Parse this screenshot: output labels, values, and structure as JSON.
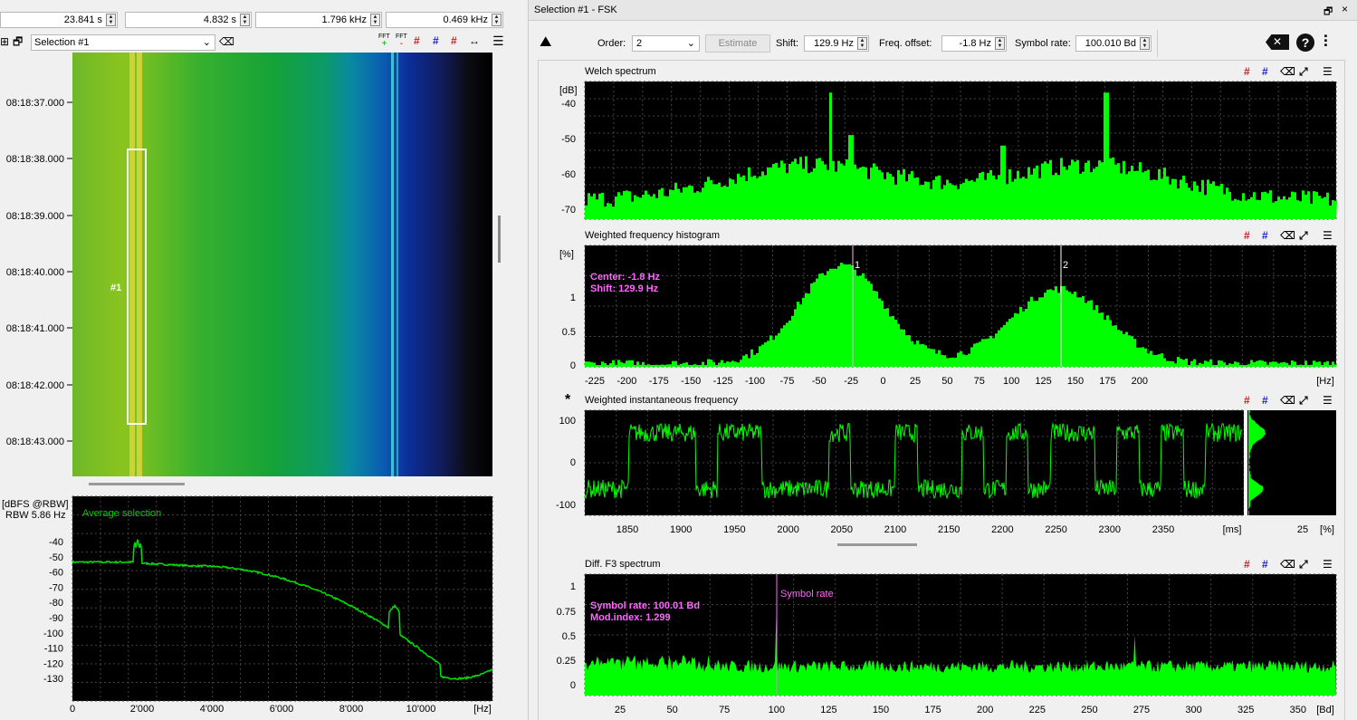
{
  "left_toolbar": {
    "time_start": "23.841 s",
    "time_span": "4.832 s",
    "freq_center": "1.796 kHz",
    "freq_span": "0.469 kHz",
    "selection_label": "Selection #1",
    "fft_plus": "FFT",
    "fft_minus": "FFT"
  },
  "waterfall": {
    "times": [
      "08:18:37.000",
      "08:18:38.000",
      "08:18:39.000",
      "08:18:40.000",
      "08:18:41.000",
      "08:18:42.000",
      "08:18:43.000"
    ],
    "marker": "#1"
  },
  "avg_spectrum": {
    "unit_label": "[dBFS @RBW]",
    "rbw": "RBW 5.86 Hz",
    "legend": "Average selection",
    "y_ticks": [
      "-40",
      "-50",
      "-60",
      "-70",
      "-80",
      "-90",
      "-100",
      "-110",
      "-120",
      "-130"
    ],
    "x_ticks": [
      "0",
      "2'000",
      "4'000",
      "6'000",
      "8'000",
      "10'000"
    ],
    "x_unit": "[Hz]"
  },
  "fsk_window": {
    "title": "Selection #1 - FSK",
    "order_label": "Order:",
    "order_value": "2",
    "estimate_label": "Estimate",
    "shift_label": "Shift:",
    "shift_value": "129.9 Hz",
    "offset_label": "Freq. offset:",
    "offset_value": "-1.8 Hz",
    "symrate_label": "Symbol rate:",
    "symrate_value": "100.010 Bd"
  },
  "welch": {
    "title": "Welch spectrum",
    "unit": "[dB]",
    "y_ticks": [
      "-40",
      "-50",
      "-60",
      "-70"
    ]
  },
  "histogram": {
    "title": "Weighted frequency histogram",
    "unit": "[%]",
    "y_ticks": [
      "1",
      "0.5",
      "0"
    ],
    "x_ticks": [
      "-225",
      "-200",
      "-175",
      "-150",
      "-125",
      "-100",
      "-75",
      "-50",
      "-25",
      "0",
      "25",
      "50",
      "75",
      "100",
      "125",
      "150",
      "175",
      "200"
    ],
    "x_unit": "[Hz]",
    "center_text": "Center: -1.8 Hz",
    "shift_text": "Shift:  129.9 Hz",
    "marker1": "1",
    "marker2": "2"
  },
  "inst_freq": {
    "title": "Weighted instantaneous frequency",
    "star": "*",
    "y_ticks": [
      "100",
      "0",
      "-100"
    ],
    "x_ticks": [
      "1850",
      "1900",
      "1950",
      "2000",
      "2050",
      "2100",
      "2150",
      "2200",
      "2250",
      "2300",
      "2350"
    ],
    "x_unit": "[ms]",
    "side_tick": "25",
    "side_unit": "[%]"
  },
  "diff_f3": {
    "title": "Diff. F3 spectrum",
    "y_ticks": [
      "1",
      "0.75",
      "0.5",
      "0.25",
      "0"
    ],
    "x_ticks": [
      "25",
      "50",
      "75",
      "100",
      "125",
      "150",
      "175",
      "200",
      "225",
      "250",
      "275",
      "300",
      "325",
      "350"
    ],
    "x_unit": "[Bd]",
    "symrate_text": "Symbol rate: 100.01 Bd",
    "modindex_text": "Mod.index: 1.299",
    "marker_label": "Symbol rate"
  },
  "colors": {
    "trace_green": "#00ff00",
    "marker_magenta": "#ff66ff",
    "plot_bg": "#000000"
  }
}
